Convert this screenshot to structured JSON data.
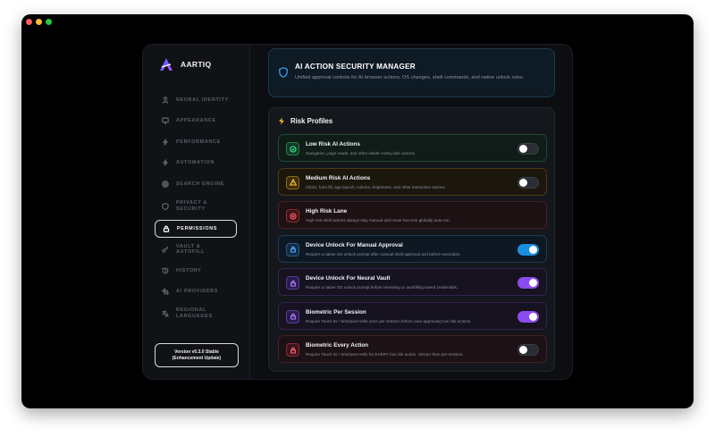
{
  "brand": {
    "name": "AARTIQ"
  },
  "sidebar": {
    "items": [
      {
        "label": "NEURAL IDENTITY",
        "icon": "user-icon"
      },
      {
        "label": "APPEARANCE",
        "icon": "monitor-icon"
      },
      {
        "label": "PERFORMANCE",
        "icon": "bolt-icon"
      },
      {
        "label": "AUTOMATION",
        "icon": "bolt-icon"
      },
      {
        "label": "SEARCH ENGINE",
        "icon": "globe-icon"
      },
      {
        "label_line1": "PRIVACY &",
        "label_line2": "SECURITY",
        "icon": "shield-icon"
      },
      {
        "label": "PERMISSIONS",
        "icon": "lock-icon",
        "active": true
      },
      {
        "label": "VAULT & AUTOFILL",
        "icon": "key-icon"
      },
      {
        "label": "HISTORY",
        "icon": "history-icon"
      },
      {
        "label": "AI PROVIDERS",
        "icon": "sparkles-icon"
      },
      {
        "label_line1": "REGIONAL",
        "label_line2": "LANGUAGES",
        "icon": "translate-icon"
      }
    ],
    "version_line1": "Version v0.3.0 Stable",
    "version_line2": "(Enhancement Update)"
  },
  "header": {
    "title": "AI ACTION SECURITY MANAGER",
    "subtitle": "Unified approval controls for AI browser actions, OS changes, shell commands, and native unlock rules."
  },
  "risk": {
    "title": "Risk Profiles",
    "rows": [
      {
        "title": "Low Risk AI Actions",
        "desc": "Navigation, page reads, and other inside-Aartiq safe actions.",
        "toggle": "off",
        "color": "green",
        "icon": "check-circle-icon"
      },
      {
        "title": "Medium Risk AI Actions",
        "desc": "Clicks, form fill, app launch, volume, brightness, and other interactive actions.",
        "toggle": "off",
        "color": "amber",
        "icon": "warning-icon"
      },
      {
        "title": "High Risk Lane",
        "desc": "High-risk shell actions always stay manual and never become globally auto-run.",
        "toggle": "none",
        "color": "red",
        "icon": "x-circle-icon"
      },
      {
        "title": "Device Unlock For Manual Approval",
        "desc": "Require a native OS unlock prompt after manual shell approval and before execution.",
        "toggle": "on",
        "color": "blue",
        "icon": "lock-icon"
      },
      {
        "title": "Device Unlock For Neural Vault",
        "desc": "Require a native OS unlock prompt before revealing or autofilling saved credentials.",
        "toggle": "on",
        "color": "purple",
        "icon": "lock-icon"
      },
      {
        "title": "Biometric Per Session",
        "desc": "Require Touch ID / Windows Hello once per session before auto-approving low risk actions.",
        "toggle": "on",
        "color": "purple",
        "icon": "lock-icon"
      },
      {
        "title": "Biometric Every Action",
        "desc": "Require Touch ID / Windows Hello for EVERY low risk action. Stricter than per-session.",
        "toggle": "off",
        "color": "rose",
        "icon": "lock-icon"
      }
    ]
  },
  "colors": {
    "accent_blue": "#1a8fe0",
    "accent_purple": "#8a4cf0",
    "header_shield": "#3aa0ff",
    "bolt": "#f5b531"
  }
}
